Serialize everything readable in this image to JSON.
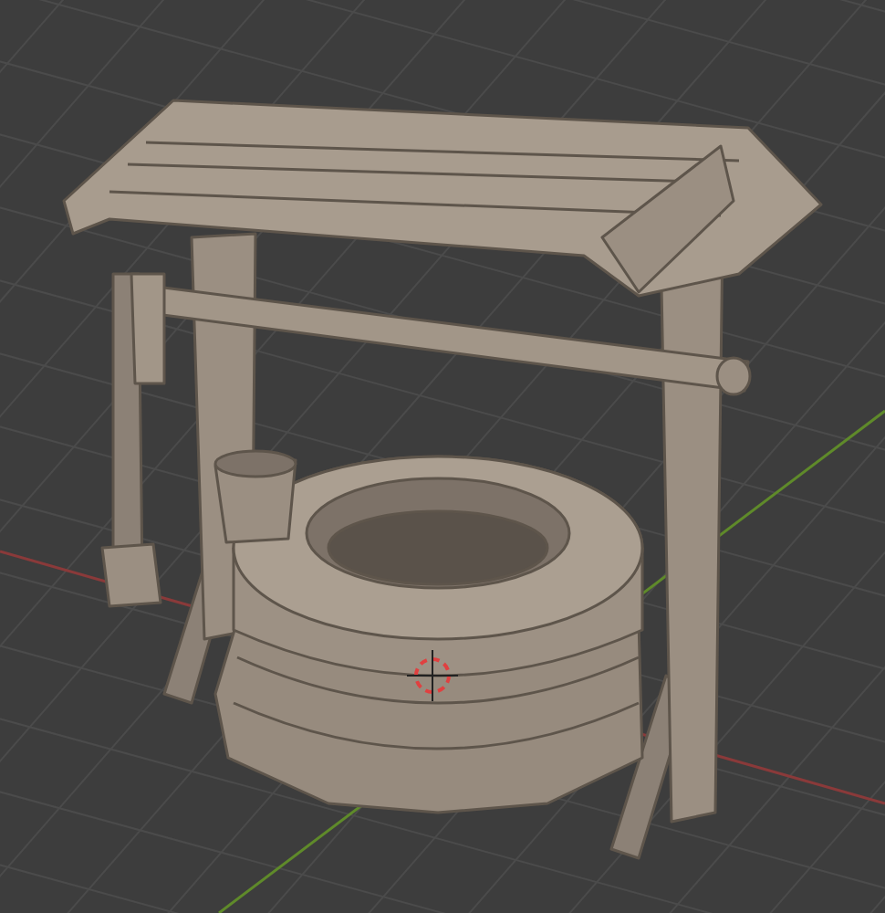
{
  "viewport": {
    "show_grid": true,
    "show_axes": true,
    "show_cursor": true
  }
}
